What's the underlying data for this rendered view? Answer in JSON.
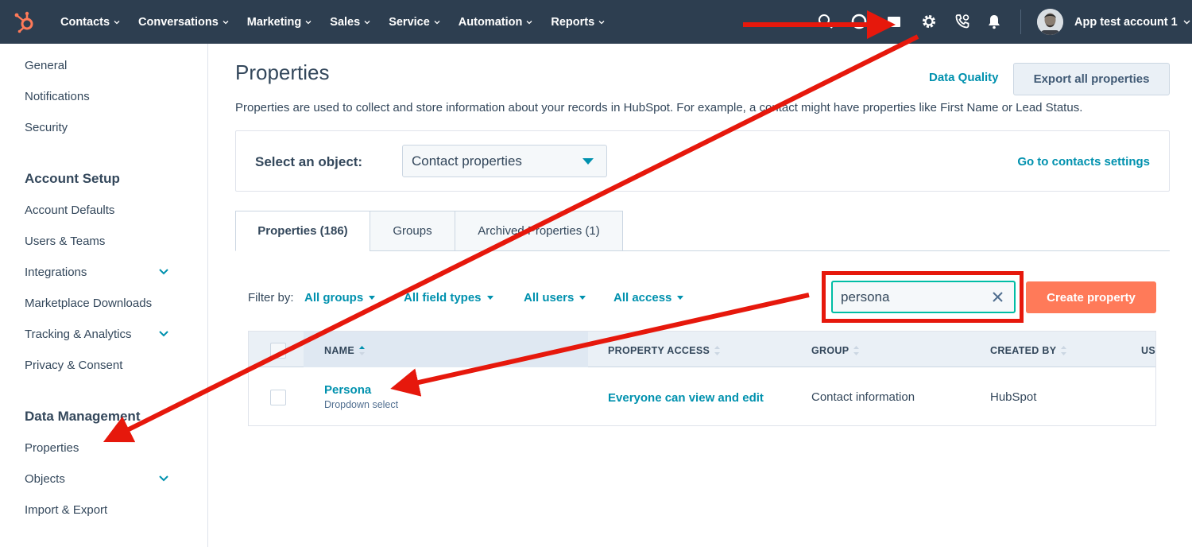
{
  "nav": {
    "menu": [
      "Contacts",
      "Conversations",
      "Marketing",
      "Sales",
      "Service",
      "Automation",
      "Reports"
    ],
    "account_name": "App test account 1",
    "icons": [
      "search-icon",
      "help-icon",
      "marketplace-icon",
      "gear-icon",
      "calling-icon",
      "bell-icon"
    ]
  },
  "sidebar": {
    "items_top": [
      "General",
      "Notifications",
      "Security"
    ],
    "account_setup": {
      "heading": "Account Setup",
      "items": [
        "Account Defaults",
        "Users & Teams",
        "Integrations",
        "Marketplace Downloads",
        "Tracking & Analytics",
        "Privacy & Consent"
      ]
    },
    "data_management": {
      "heading": "Data Management",
      "items": [
        "Properties",
        "Objects",
        "Import & Export"
      ]
    }
  },
  "page": {
    "title": "Properties",
    "data_quality": "Data Quality",
    "export_button": "Export all properties",
    "description": "Properties are used to collect and store information about your records in HubSpot. For example, a contact might have properties like First Name or Lead Status.",
    "select_object_label": "Select an object:",
    "select_object_value": "Contact properties",
    "goto_settings": "Go to contacts settings",
    "tabs": [
      "Properties (186)",
      "Groups",
      "Archived Properties (1)"
    ],
    "filter_label": "Filter by:",
    "filters": [
      "All groups",
      "All field types",
      "All users",
      "All access"
    ],
    "search_value": "persona",
    "create_button": "Create property"
  },
  "table": {
    "headers": [
      "NAME",
      "PROPERTY ACCESS",
      "GROUP",
      "CREATED BY",
      "US"
    ],
    "rows": [
      {
        "name": "Persona",
        "type": "Dropdown select",
        "access": "Everyone can view and edit",
        "group": "Contact information",
        "created_by": "HubSpot"
      }
    ]
  },
  "colors": {
    "nav_bg": "#2d3e50",
    "link": "#0091ae",
    "primary_button": "#ff7a59",
    "annotation": "#e6180c",
    "logo": "#ff7a59"
  }
}
